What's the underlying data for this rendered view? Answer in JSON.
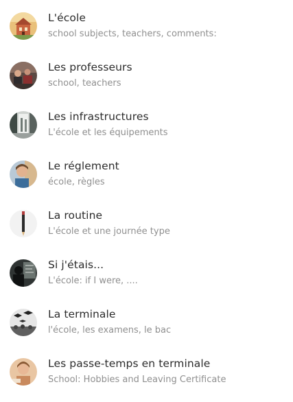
{
  "items": [
    {
      "title": "L'école",
      "subtitle": "school subjects, teachers, comments:",
      "thumbnail": "school-building-photo"
    },
    {
      "title": "Les professeurs",
      "subtitle": "school, teachers",
      "thumbnail": "teachers-classroom-photo"
    },
    {
      "title": "Les infrastructures",
      "subtitle": "L'école et les équipements",
      "thumbnail": "school-hallway-photo"
    },
    {
      "title": "Le réglement",
      "subtitle": "école, règles",
      "thumbnail": "student-portrait-photo"
    },
    {
      "title": "La routine",
      "subtitle": "L'école et une journée type",
      "thumbnail": "pencil-photo"
    },
    {
      "title": "Si j'étais...",
      "subtitle": "L'école: if I were, ....",
      "thumbnail": "silhouette-blackboard-photo"
    },
    {
      "title": "La terminale",
      "subtitle": "l'école, les examens, le bac",
      "thumbnail": "graduation-caps-photo"
    },
    {
      "title": "Les passe-temps en terminale",
      "subtitle": "School: Hobbies and Leaving Certificate",
      "thumbnail": "student-hobby-photo"
    }
  ]
}
